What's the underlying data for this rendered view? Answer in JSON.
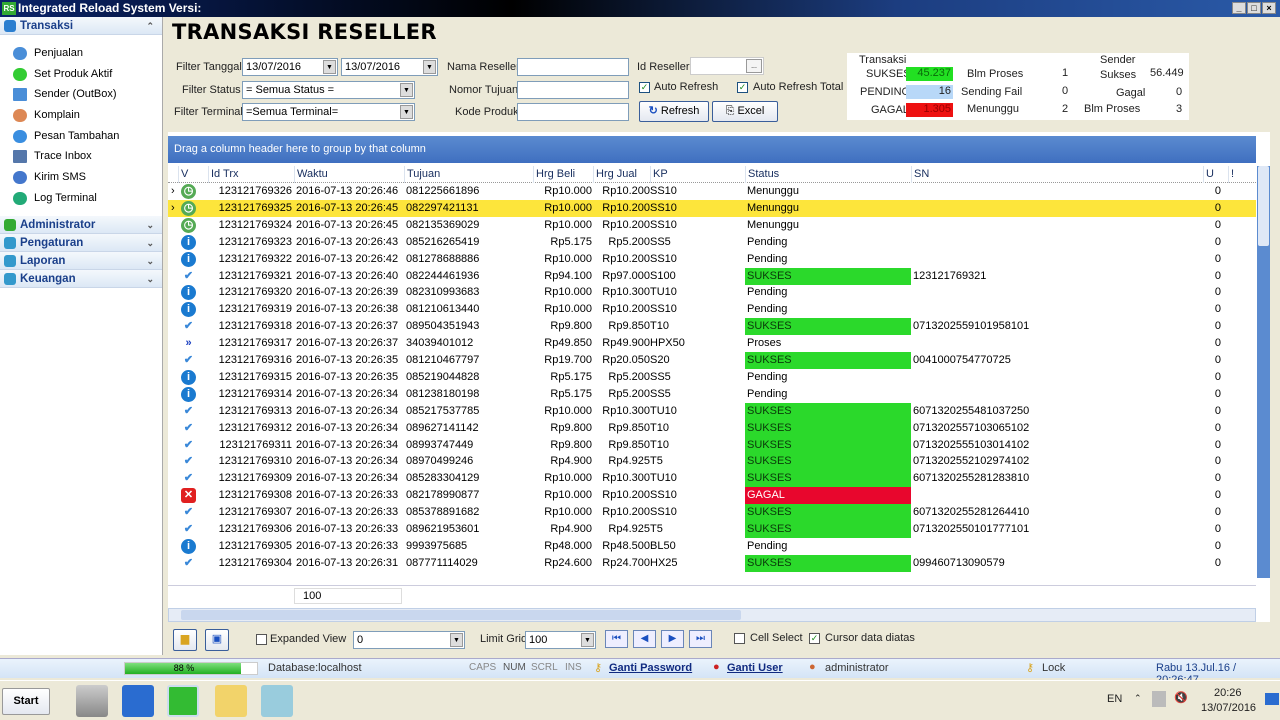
{
  "window": {
    "title": "Integrated Reload System Versi:",
    "logo": "RS"
  },
  "sidebar": {
    "groups": [
      {
        "label": "Transaksi",
        "items": [
          "Penjualan",
          "Set Produk Aktif",
          "Sender (OutBox)",
          "Komplain",
          "Pesan Tambahan",
          "Trace Inbox",
          "Kirim SMS",
          "Log Terminal"
        ]
      },
      {
        "label": "Administrator"
      },
      {
        "label": "Pengaturan"
      },
      {
        "label": "Laporan"
      },
      {
        "label": "Keuangan"
      }
    ]
  },
  "page": {
    "title": "TRANSAKSI RESELLER"
  },
  "filters": {
    "tanggal_label": "Filter Tanggal",
    "date_from": "13/07/2016",
    "date_to": "13/07/2016",
    "status_label": "Filter Status",
    "status_value": "= Semua Status =",
    "terminal_label": "Filter Terminal",
    "terminal_value": "=Semua Terminal=",
    "nama_reseller_label": "Nama Reseller",
    "nomor_tujuan_label": "Nomor Tujuan",
    "kode_produk_label": "Kode Produk",
    "id_reseller_label": "Id Reseller",
    "browse": "...",
    "auto_refresh": "Auto Refresh",
    "auto_refresh_checked": true,
    "auto_refresh_total": "Auto Refresh Total",
    "auto_refresh_total_checked": true,
    "refresh": "Refresh",
    "excel": "Excel"
  },
  "stats": {
    "transaksi": "Transaksi",
    "sukses_label": "SUKSES",
    "sukses": "45.237",
    "pending_label": "PENDING",
    "pending": "16",
    "gagal_label": "GAGAL",
    "gagal": "1.305",
    "blm_proses_label": "Blm Proses",
    "blm_proses": "1",
    "sending_fail_label": "Sending Fail",
    "sending_fail": "0",
    "menunggu_label": "Menunggu",
    "menunggu": "2",
    "sender": "Sender",
    "sender_sukses_label": "Sukses",
    "sender_sukses": "56.449",
    "sender_gagal_label": "Gagal",
    "sender_gagal": "0",
    "sender_blm_label": "Blm Proses",
    "sender_blm": "3",
    "colors": {
      "sukses": "#22e022",
      "pending": "#b8d8f8",
      "gagal": "#ee1111"
    }
  },
  "grid": {
    "group_hint": "Drag a column header here to group by that column",
    "columns": [
      "V",
      "Id Trx",
      "Waktu",
      "Tujuan",
      "Hrg Beli",
      "Hrg Jual",
      "KP",
      "Status",
      "SN",
      "U",
      "!"
    ],
    "rows": [
      [
        "clock",
        "123121769326",
        "2016-07-13 20:26:46",
        "081225661896",
        "Rp10.000",
        "Rp10.200",
        "SS10",
        "Menunggu",
        "",
        "0"
      ],
      [
        "clock",
        "123121769325",
        "2016-07-13 20:26:45",
        "082297421131",
        "Rp10.000",
        "Rp10.200",
        "SS10",
        "Menunggu",
        "",
        "0"
      ],
      [
        "clock",
        "123121769324",
        "2016-07-13 20:26:45",
        "082135369029",
        "Rp10.000",
        "Rp10.200",
        "SS10",
        "Menunggu",
        "",
        "0"
      ],
      [
        "info",
        "123121769323",
        "2016-07-13 20:26:43",
        "085216265419",
        "Rp5.175",
        "Rp5.200",
        "SS5",
        "Pending",
        "",
        "0"
      ],
      [
        "info",
        "123121769322",
        "2016-07-13 20:26:42",
        "081278688886",
        "Rp10.000",
        "Rp10.200",
        "SS10",
        "Pending",
        "",
        "0"
      ],
      [
        "check",
        "123121769321",
        "2016-07-13 20:26:40",
        "082244461936",
        "Rp94.100",
        "Rp97.000",
        "S100",
        "SUKSES",
        "123121769321",
        "0"
      ],
      [
        "info",
        "123121769320",
        "2016-07-13 20:26:39",
        "082310993683",
        "Rp10.000",
        "Rp10.300",
        "TU10",
        "Pending",
        "",
        "0"
      ],
      [
        "info",
        "123121769319",
        "2016-07-13 20:26:38",
        "081210613440",
        "Rp10.000",
        "Rp10.200",
        "SS10",
        "Pending",
        "",
        "0"
      ],
      [
        "check",
        "123121769318",
        "2016-07-13 20:26:37",
        "089504351943",
        "Rp9.800",
        "Rp9.850",
        "T10",
        "SUKSES",
        "0713202559101958101",
        "0"
      ],
      [
        "process",
        "123121769317",
        "2016-07-13 20:26:37",
        "34039401012",
        "Rp49.850",
        "Rp49.900",
        "HPX50",
        "Proses",
        "",
        "0"
      ],
      [
        "check",
        "123121769316",
        "2016-07-13 20:26:35",
        "081210467797",
        "Rp19.700",
        "Rp20.050",
        "S20",
        "SUKSES",
        "0041000754770725",
        "0"
      ],
      [
        "info",
        "123121769315",
        "2016-07-13 20:26:35",
        "085219044828",
        "Rp5.175",
        "Rp5.200",
        "SS5",
        "Pending",
        "",
        "0"
      ],
      [
        "info",
        "123121769314",
        "2016-07-13 20:26:34",
        "081238180198",
        "Rp5.175",
        "Rp5.200",
        "SS5",
        "Pending",
        "",
        "0"
      ],
      [
        "check",
        "123121769313",
        "2016-07-13 20:26:34",
        "085217537785",
        "Rp10.000",
        "Rp10.300",
        "TU10",
        "SUKSES",
        "6071320255481037250",
        "0"
      ],
      [
        "check",
        "123121769312",
        "2016-07-13 20:26:34",
        "089627141142",
        "Rp9.800",
        "Rp9.850",
        "T10",
        "SUKSES",
        "0713202557103065102",
        "0"
      ],
      [
        "check",
        "123121769311",
        "2016-07-13 20:26:34",
        "08993747449",
        "Rp9.800",
        "Rp9.850",
        "T10",
        "SUKSES",
        "0713202555103014102",
        "0"
      ],
      [
        "check",
        "123121769310",
        "2016-07-13 20:26:34",
        "08970499246",
        "Rp4.900",
        "Rp4.925",
        "T5",
        "SUKSES",
        "0713202552102974102",
        "0"
      ],
      [
        "check",
        "123121769309",
        "2016-07-13 20:26:34",
        "085283304129",
        "Rp10.000",
        "Rp10.300",
        "TU10",
        "SUKSES",
        "6071320255281283810",
        "0"
      ],
      [
        "fail",
        "123121769308",
        "2016-07-13 20:26:33",
        "082178990877",
        "Rp10.000",
        "Rp10.200",
        "SS10",
        "GAGAL",
        "",
        "0"
      ],
      [
        "check",
        "123121769307",
        "2016-07-13 20:26:33",
        "085378891682",
        "Rp10.000",
        "Rp10.200",
        "SS10",
        "SUKSES",
        "6071320255281264410",
        "0"
      ],
      [
        "check",
        "123121769306",
        "2016-07-13 20:26:33",
        "089621953601",
        "Rp4.900",
        "Rp4.925",
        "T5",
        "SUKSES",
        "0713202550101777101",
        "0"
      ],
      [
        "info",
        "123121769305",
        "2016-07-13 20:26:33",
        "9993975685",
        "Rp48.000",
        "Rp48.500",
        "BL50",
        "Pending",
        "",
        "0"
      ],
      [
        "check",
        "123121769304",
        "2016-07-13 20:26:31",
        "087771114029",
        "Rp24.600",
        "Rp24.700",
        "HX25",
        "SUKSES",
        "099460713090579",
        "0"
      ]
    ],
    "selected_index": 1,
    "footer_count": "100",
    "status_colors": {
      "SUKSES": "#2bd92b",
      "GAGAL": "#e8062d",
      "selected": "#fde53b"
    }
  },
  "toolbar": {
    "expanded_view": "Expanded View",
    "expanded_value": "0",
    "limit_label": "Limit Grid",
    "limit_value": "100",
    "cell_select": "Cell Select",
    "cursor_top": "Cursor data diatas"
  },
  "statusbar": {
    "progress_label": "88 %",
    "progress": 88,
    "database": "Database:localhost",
    "caps": "CAPS",
    "num": "NUM",
    "scrl": "SCRL",
    "ins": "INS",
    "ganti_password": "Ganti Password",
    "ganti_user": "Ganti User",
    "user": "administrator",
    "lock": "Lock",
    "datetime": "Rabu 13.Jul.16 / 20:26:47"
  },
  "taskbar": {
    "start": "Start",
    "lang": "EN",
    "time": "20:26",
    "date": "13/07/2016"
  }
}
